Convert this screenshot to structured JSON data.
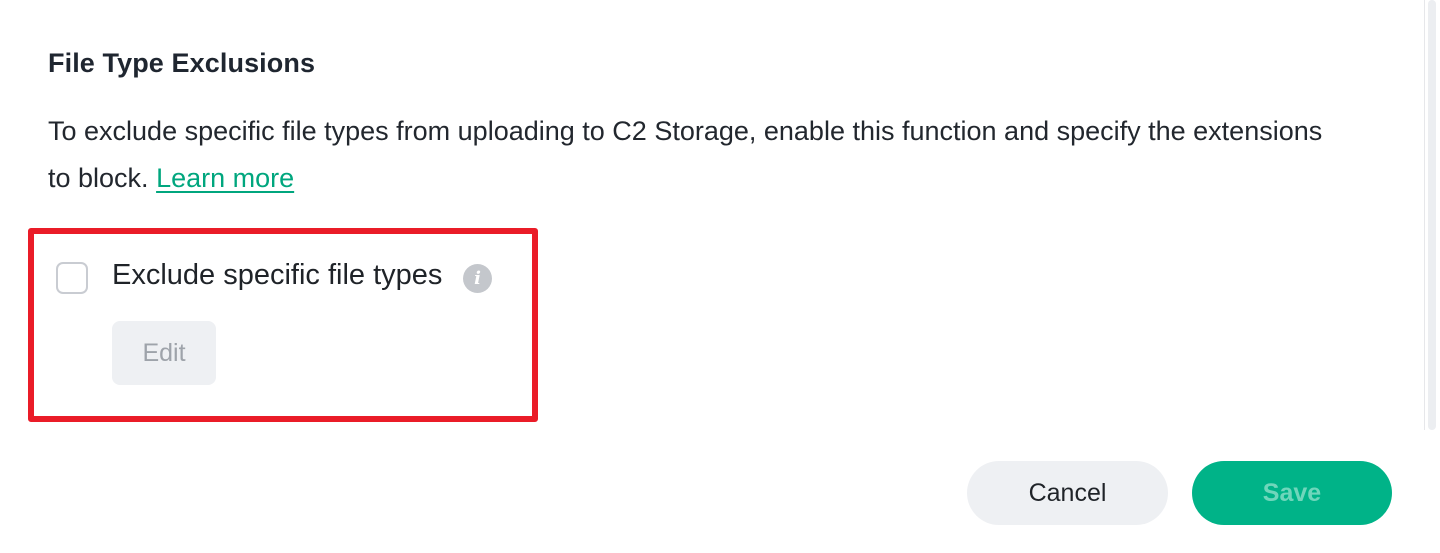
{
  "section": {
    "title": "File Type Exclusions",
    "description": "To exclude specific file types from uploading to C2 Storage, enable this function and specify the extensions to block.",
    "learn_more_label": "Learn more"
  },
  "exclude_option": {
    "label": "Exclude specific file types",
    "checked": false,
    "info_icon": "info-icon",
    "edit_label": "Edit"
  },
  "footer": {
    "cancel_label": "Cancel",
    "save_label": "Save"
  },
  "colors": {
    "accent": "#00b388",
    "link": "#00a67e",
    "highlight": "#ea1c28"
  }
}
